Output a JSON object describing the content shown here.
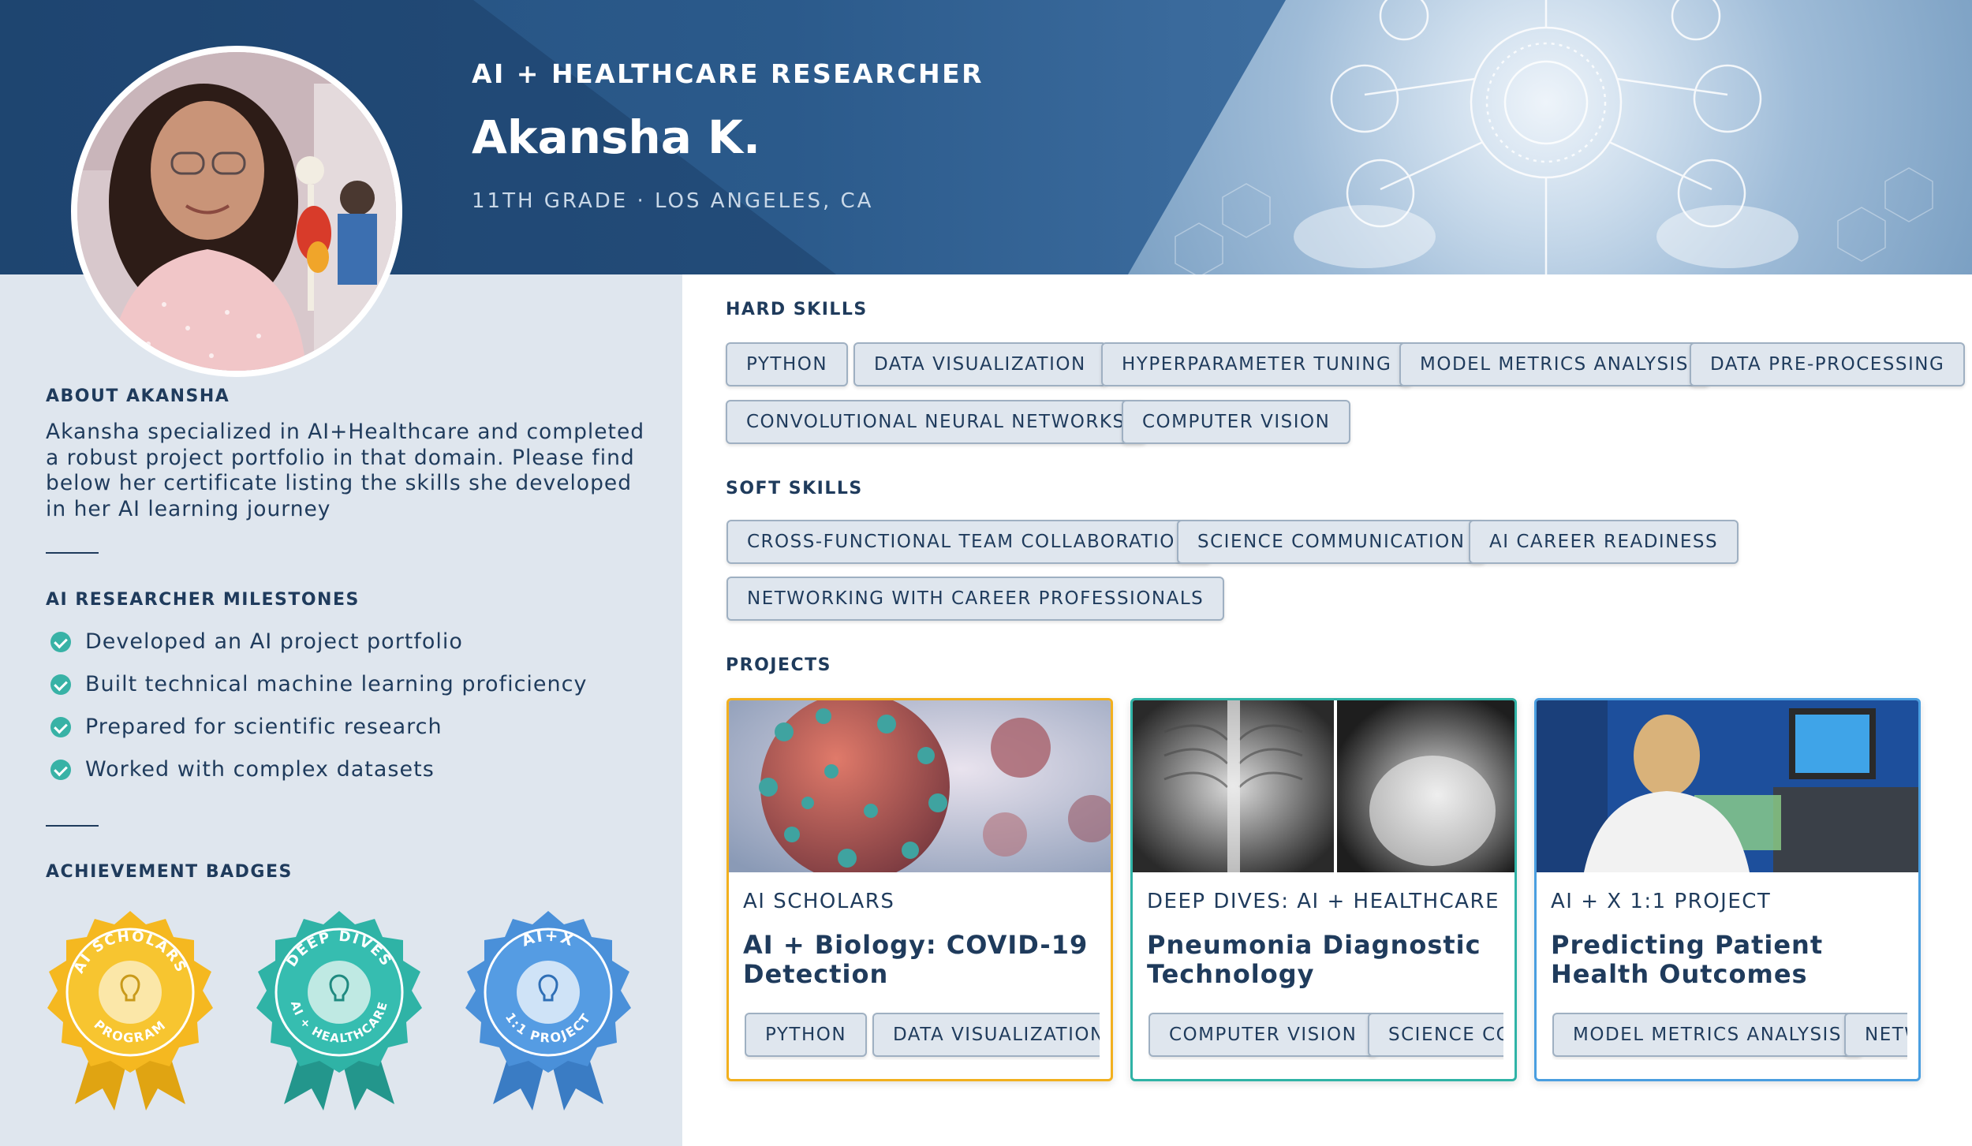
{
  "header": {
    "role": "AI + HEALTHCARE RESEARCHER",
    "name": "Akansha K.",
    "subtitle": "11TH GRADE · LOS ANGELES, CA"
  },
  "about": {
    "label": "ABOUT AKANSHA",
    "text": "Akansha specialized in AI+Healthcare and completed a robust project portfolio in that domain. Please find below her certificate listing the skills she developed in her AI learning journey"
  },
  "milestones": {
    "label": "AI RESEARCHER MILESTONES",
    "items": [
      "Developed an AI project portfolio",
      "Built technical machine learning proficiency",
      "Prepared for scientific research",
      "Worked with complex datasets"
    ]
  },
  "badges": {
    "label": "ACHIEVEMENT BADGES",
    "items": [
      {
        "top": "AI SCHOLARS",
        "bottom": "PROGRAM",
        "color": "#f5b820"
      },
      {
        "top": "DEEP DIVES",
        "bottom": "AI + HEALTHCARE",
        "color": "#2fb3a6"
      },
      {
        "top": "AI+X",
        "bottom": "1:1 PROJECT",
        "color": "#4a90d9"
      }
    ]
  },
  "hard_skills": {
    "label": "HARD SKILLS",
    "items": [
      "PYTHON",
      "DATA VISUALIZATION",
      "HYPERPARAMETER TUNING",
      "MODEL METRICS ANALYSIS",
      "DATA PRE-PROCESSING",
      "CONVOLUTIONAL NEURAL NETWORKS",
      "COMPUTER VISION"
    ]
  },
  "soft_skills": {
    "label": "SOFT SKILLS",
    "items": [
      "CROSS-FUNCTIONAL TEAM COLLABORATION",
      "SCIENCE COMMUNICATION",
      "AI CAREER READINESS",
      "NETWORKING WITH CAREER PROFESSIONALS"
    ]
  },
  "projects": {
    "label": "PROJECTS",
    "items": [
      {
        "category": "AI SCHOLARS",
        "title": "AI + Biology: COVID-19 Detection",
        "border": "#f2b01e",
        "chips": [
          "PYTHON",
          "DATA VISUALIZATION"
        ]
      },
      {
        "category": "DEEP DIVES: AI + HEALTHCARE",
        "title": "Pneumonia Diagnostic Technology",
        "border": "#2fb3a6",
        "chips": [
          "COMPUTER VISION",
          "SCIENCE COMMUNICATION"
        ]
      },
      {
        "category": "AI + X 1:1 PROJECT",
        "title": "Predicting Patient Health Outcomes",
        "border": "#4a9ee0",
        "chips": [
          "MODEL METRICS ANALYSIS",
          "NETWORKING WITH CAREER PROFESSIONALS"
        ]
      }
    ]
  },
  "colors": {
    "navy": "#24507f",
    "text": "#1f3b5c",
    "panel": "#dfe6ee",
    "teal": "#38b2a6"
  }
}
